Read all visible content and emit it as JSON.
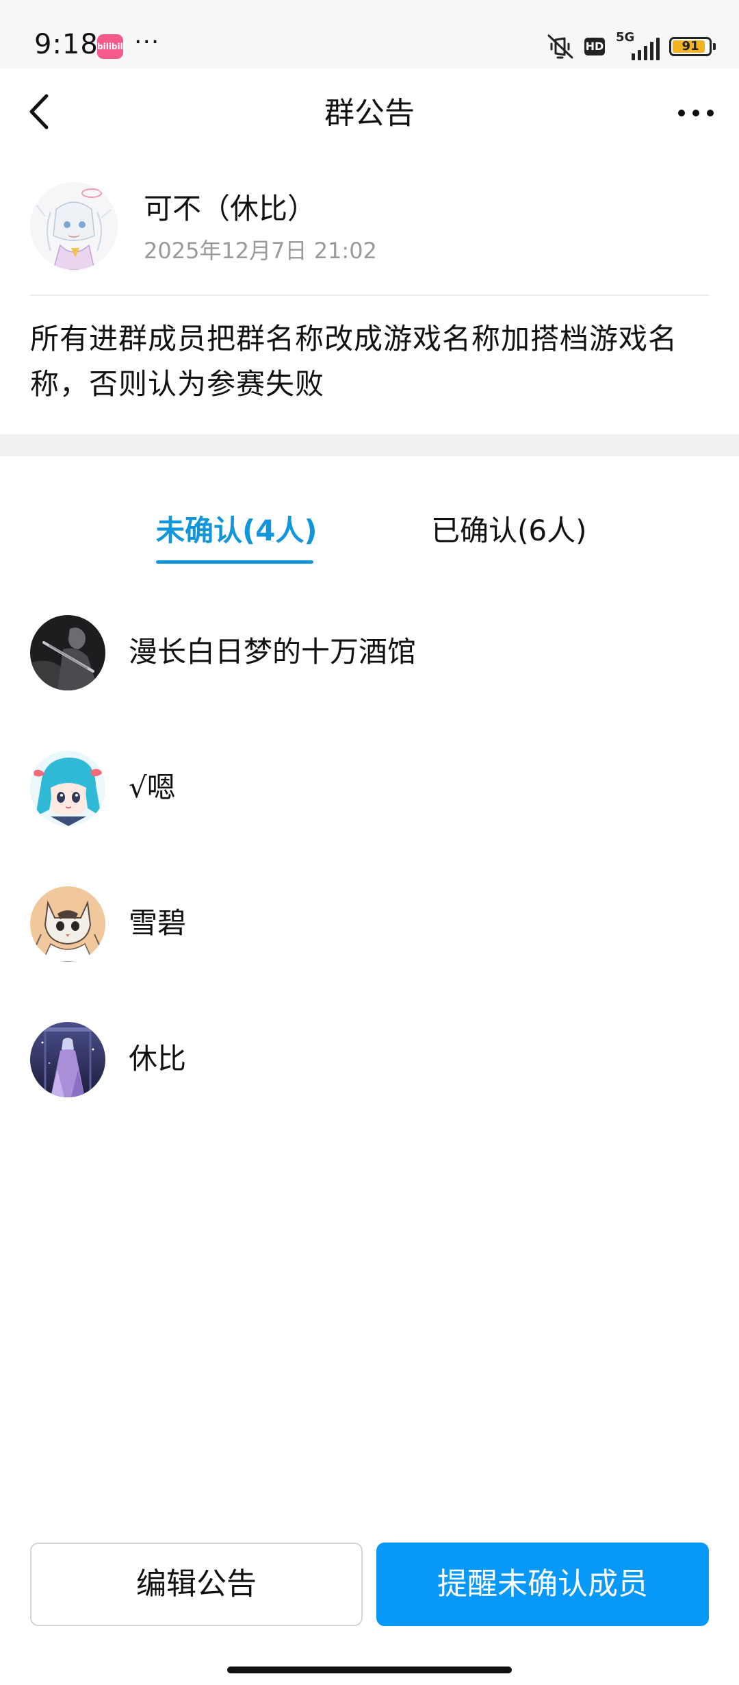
{
  "status_bar": {
    "time": "9:18",
    "app_badge": "bilibili",
    "more": "···",
    "network_label": "5G",
    "hd_label": "HD",
    "battery_level": "91",
    "icons": [
      "bilibili-app-icon",
      "mute-icon",
      "hd-icon",
      "signal-icon",
      "battery-icon"
    ]
  },
  "nav": {
    "title": "群公告",
    "back_icon": "chevron-left-icon",
    "more_icon": "more-horizontal-icon"
  },
  "announcement": {
    "author_name": "可不（休比）",
    "timestamp": "2025年12月7日 21:02",
    "body": "所有进群成员把群名称改成游戏名称加搭档游戏名称，否则认为参赛失败"
  },
  "tabs": {
    "unconfirmed": "未确认(4人)",
    "confirmed": "已确认(6人)",
    "active": "unconfirmed"
  },
  "members": [
    {
      "name": "漫长白日梦的十万酒馆"
    },
    {
      "name": "√嗯"
    },
    {
      "name": "雪碧"
    },
    {
      "name": "休比"
    }
  ],
  "actions": {
    "edit_label": "编辑公告",
    "remind_label": "提醒未确认成员"
  },
  "colors": {
    "accent": "#1296db",
    "primary_button": "#0899f8",
    "battery": "#f2b31f",
    "app_badge": "#f45a8a"
  }
}
